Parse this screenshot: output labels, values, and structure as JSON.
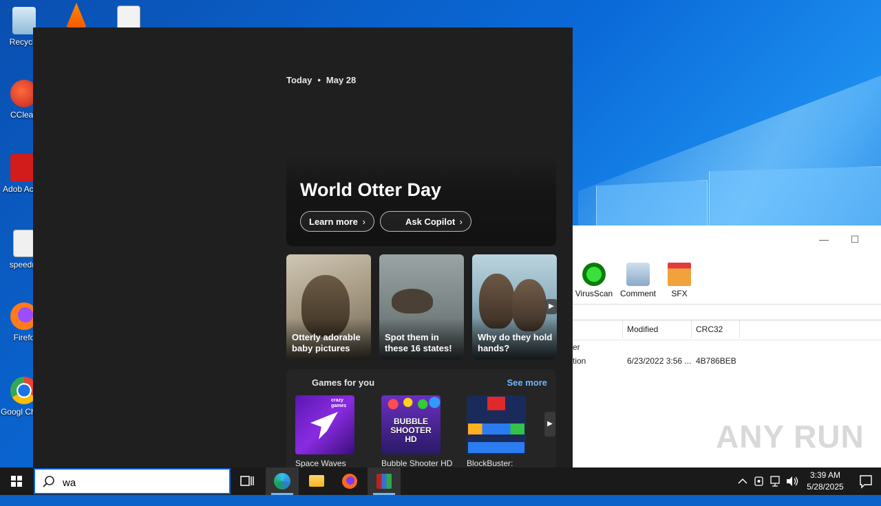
{
  "desktop": {
    "icons": [
      {
        "label": "Recycle"
      },
      {
        "label": "CClean"
      },
      {
        "label": "Adob Acrob"
      },
      {
        "label": "speedm"
      },
      {
        "label": "Firefo"
      },
      {
        "label": "Googl Chron"
      }
    ]
  },
  "winrar": {
    "toolbar": [
      {
        "label": "VirusScan",
        "icon": "virus-scan-icon"
      },
      {
        "label": "Comment",
        "icon": "comment-icon"
      },
      {
        "label": "SFX",
        "icon": "sfx-icon"
      }
    ],
    "columns": [
      "Modified",
      "CRC32"
    ],
    "rows": [
      {
        "name": "er",
        "modified": "",
        "crc": ""
      },
      {
        "name": "tion",
        "modified": "6/23/2022 3:56 ...",
        "crc": "4B786BEB"
      }
    ],
    "controls": {
      "minimize": "—",
      "maximize": "☐"
    }
  },
  "watermark": "ANY RUN",
  "search_panel": {
    "today_label": "Today",
    "date": "May 28",
    "hero": {
      "title": "World Otter Day",
      "buttons": [
        "Learn more",
        "Ask Copilot"
      ]
    },
    "cards": [
      {
        "caption": "Otterly adorable baby pictures"
      },
      {
        "caption": "Spot them in these 16 states!"
      },
      {
        "caption": "Why do they hold hands?"
      }
    ],
    "games": {
      "title": "Games for you",
      "see_more": "See more",
      "items": [
        {
          "name": "Space Waves"
        },
        {
          "name": "Bubble Shooter HD"
        },
        {
          "name": "BlockBuster:"
        }
      ],
      "tile_text": {
        "crazy": "crazy games",
        "bubble": "BUBBLE SHOOTER HD"
      }
    }
  },
  "taskbar": {
    "search_value": "wa",
    "time": "3:39 AM",
    "date": "5/28/2025"
  },
  "colors": {
    "panel_bg": "#1f1f1f",
    "accent_link": "#6fb7ff",
    "taskbar_bg": "#1a1a1a"
  }
}
